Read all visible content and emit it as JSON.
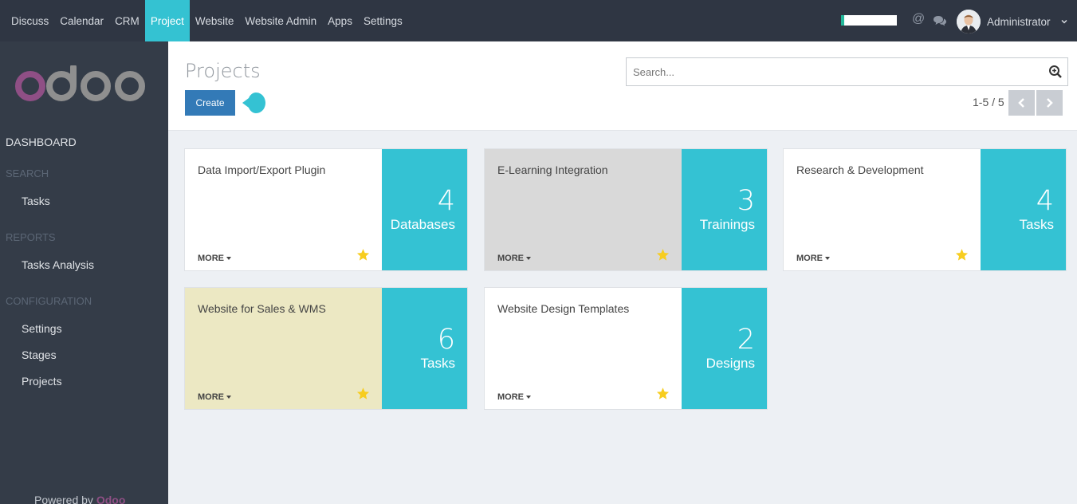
{
  "topbar": {
    "menus": [
      "Discuss",
      "Calendar",
      "CRM",
      "Project",
      "Website",
      "Website Admin",
      "Apps",
      "Settings"
    ],
    "active_menu": "Project",
    "user_name": "Administrator"
  },
  "sidebar": {
    "dashboard": "DASHBOARD",
    "search_header": "SEARCH",
    "tasks": "Tasks",
    "reports_header": "REPORTS",
    "tasks_analysis": "Tasks Analysis",
    "config_header": "CONFIGURATION",
    "settings": "Settings",
    "stages": "Stages",
    "projects": "Projects",
    "powered_by": "Powered by",
    "brand": "Odoo"
  },
  "control_panel": {
    "title": "Projects",
    "create_label": "Create",
    "search_placeholder": "Search...",
    "pager": "1-5 / 5"
  },
  "projects": [
    {
      "name": "Data Import/Export Plugin",
      "count": "4",
      "label": "Databases",
      "color": "#ffffff",
      "more": "MORE"
    },
    {
      "name": "E-Learning Integration",
      "count": "3",
      "label": "Trainings",
      "color": "#d9d9d9",
      "more": "MORE"
    },
    {
      "name": "Research & Development",
      "count": "4",
      "label": "Tasks",
      "color": "#ffffff",
      "more": "MORE"
    },
    {
      "name": "Website for Sales & WMS",
      "count": "6",
      "label": "Tasks",
      "color": "#ece8c3",
      "more": "MORE"
    },
    {
      "name": "Website Design Templates",
      "count": "2",
      "label": "Designs",
      "color": "#ffffff",
      "more": "MORE"
    }
  ],
  "colors": {
    "accent": "#34c2d3",
    "topbar": "#2f3643",
    "sidebar": "#343c48",
    "create_button": "#337ab7",
    "star": "#f7cd1f"
  },
  "icons": {
    "search": "search-icon",
    "star": "star-icon",
    "mention": "at-sign-icon",
    "chat": "chat-bubbles-icon"
  }
}
